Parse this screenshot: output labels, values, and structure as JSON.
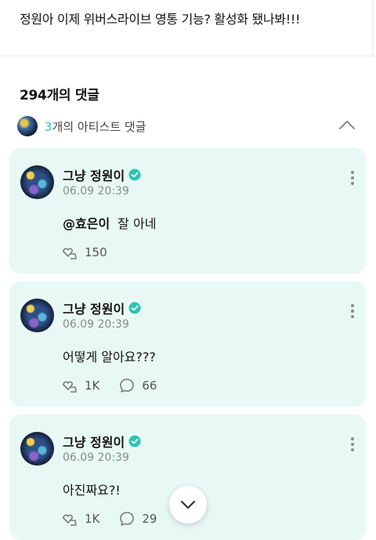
{
  "post": {
    "text": "정원아 이제 위버스라이브 영통 기능? 활성화 됐나봐!!!"
  },
  "comments_header": {
    "count_label": "294개의 댓글"
  },
  "artist_comments": {
    "count": "3",
    "label": "개의 아티스트 댓글"
  },
  "comments": [
    {
      "author": "그냥 정원이",
      "date": "06.09 20:39",
      "mention": "@효은이",
      "text": "잘 아네",
      "likes": "150",
      "replies": ""
    },
    {
      "author": "그냥 정원이",
      "date": "06.09 20:39",
      "mention": "",
      "text": "어떻게 알아요???",
      "likes": "1K",
      "replies": "66"
    },
    {
      "author": "그냥 정원이",
      "date": "06.09 20:39",
      "mention": "",
      "text": "아진짜요?!",
      "likes": "1K",
      "replies": "29"
    }
  ],
  "colors": {
    "card_bg": "#e8f9f5",
    "accent": "#2ec4b6",
    "verified": "#2ec4b6"
  },
  "icons": [
    "chevron-up-icon",
    "verified-icon",
    "more-icon",
    "like-icon",
    "reply-icon",
    "chevron-down-icon"
  ]
}
